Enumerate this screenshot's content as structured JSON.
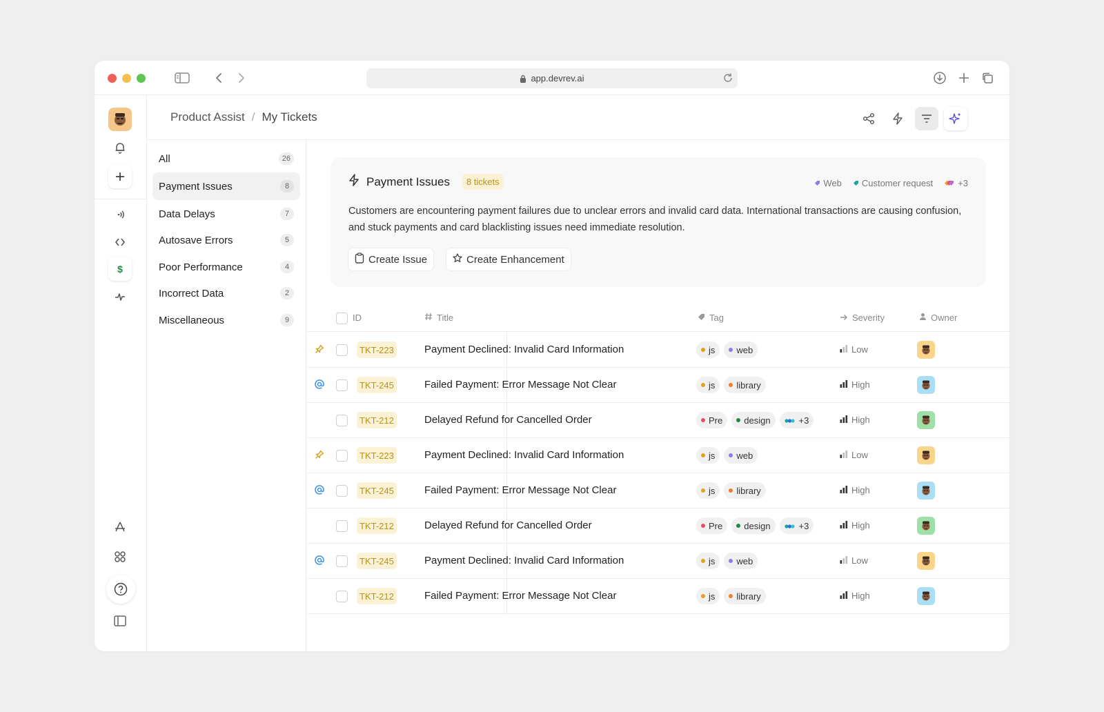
{
  "browser": {
    "url": "app.devrev.ai",
    "traffic_colors": {
      "close": "#ed5f57",
      "minimize": "#f5bf4f",
      "maximize": "#61c554"
    }
  },
  "rail": {
    "items": [
      "avatar",
      "bell-icon",
      "plus-icon",
      "broadcast-icon",
      "code-icon",
      "dollar-icon",
      "pulse-icon",
      "apps-store-icon",
      "grid-icon",
      "help-icon",
      "panel-icon"
    ],
    "active_glyph": "$"
  },
  "header": {
    "breadcrumb": [
      "Product Assist",
      "My Tickets"
    ],
    "separator": "/",
    "actions": [
      "share-icon",
      "bolt-icon",
      "filter-icon",
      "sparkle-icon"
    ]
  },
  "categories": [
    {
      "label": "All",
      "count": "26"
    },
    {
      "label": "Payment Issues",
      "count": "8",
      "active": true
    },
    {
      "label": "Data Delays",
      "count": "7"
    },
    {
      "label": "Autosave Errors",
      "count": "5"
    },
    {
      "label": "Poor Performance",
      "count": "4"
    },
    {
      "label": "Incorrect Data",
      "count": "2"
    },
    {
      "label": "Miscellaneous",
      "count": "9"
    }
  ],
  "summary": {
    "title": "Payment Issues",
    "badge": "8 tickets",
    "tags": [
      {
        "label": "Web",
        "color": "#8e7be6"
      },
      {
        "label": "Customer request",
        "color": "#1aa39a"
      },
      {
        "label": "+3",
        "color": "#b76be0"
      }
    ],
    "description": "Customers are encountering payment failures due to unclear errors and invalid card data. International transactions are causing confusion, and stuck payments and card blacklisting issues need immediate resolution.",
    "buttons": {
      "create_issue": "Create Issue",
      "create_enhancement": "Create Enhancement"
    }
  },
  "table": {
    "columns": {
      "id": "ID",
      "title": "Title",
      "tag": "Tag",
      "severity": "Severity",
      "owner": "Owner"
    },
    "rows": [
      {
        "mark": "pin",
        "id": "TKT-223",
        "title": "Payment Declined: Invalid Card Information",
        "tags": [
          {
            "label": "js",
            "color": "#e0a21e"
          },
          {
            "label": "web",
            "color": "#8e7be6"
          }
        ],
        "severity": "Low",
        "owner_color": "#f8d58a"
      },
      {
        "mark": "at",
        "id": "TKT-245",
        "title": "Failed Payment: Error Message Not Clear",
        "tags": [
          {
            "label": "js",
            "color": "#e0a21e"
          },
          {
            "label": "library",
            "color": "#f07d2c"
          }
        ],
        "severity": "High",
        "owner_color": "#a9def5"
      },
      {
        "mark": "",
        "id": "TKT-212",
        "title": "Delayed Refund for Cancelled Order",
        "tags": [
          {
            "label": "Pre",
            "color": "#e84f65"
          },
          {
            "label": "design",
            "color": "#1f8a45"
          },
          {
            "label": "+3",
            "color": "#1aa39a"
          }
        ],
        "severity": "High",
        "owner_color": "#9fe0a9"
      },
      {
        "mark": "pin",
        "id": "TKT-223",
        "title": "Payment Declined: Invalid Card Information",
        "tags": [
          {
            "label": "js",
            "color": "#e0a21e"
          },
          {
            "label": "web",
            "color": "#8e7be6"
          }
        ],
        "severity": "Low",
        "owner_color": "#f8d58a"
      },
      {
        "mark": "at",
        "id": "TKT-245",
        "title": "Failed Payment: Error Message Not Clear",
        "tags": [
          {
            "label": "js",
            "color": "#e0a21e"
          },
          {
            "label": "library",
            "color": "#f07d2c"
          }
        ],
        "severity": "High",
        "owner_color": "#a9def5"
      },
      {
        "mark": "",
        "id": "TKT-212",
        "title": "Delayed Refund for Cancelled Order",
        "tags": [
          {
            "label": "Pre",
            "color": "#e84f65"
          },
          {
            "label": "design",
            "color": "#1f8a45"
          },
          {
            "label": "+3",
            "color": "#1aa39a"
          }
        ],
        "severity": "High",
        "owner_color": "#9fe0a9"
      },
      {
        "mark": "at",
        "id": "TKT-245",
        "title": "Payment Declined: Invalid Card Information",
        "tags": [
          {
            "label": "js",
            "color": "#e0a21e"
          },
          {
            "label": "web",
            "color": "#8e7be6"
          }
        ],
        "severity": "Low",
        "owner_color": "#f8d58a"
      },
      {
        "mark": "",
        "id": "TKT-212",
        "title": "Failed Payment: Error Message Not Clear",
        "tags": [
          {
            "label": "js",
            "color": "#e0a21e"
          },
          {
            "label": "library",
            "color": "#f07d2c"
          }
        ],
        "severity": "High",
        "owner_color": "#a9def5"
      }
    ]
  }
}
